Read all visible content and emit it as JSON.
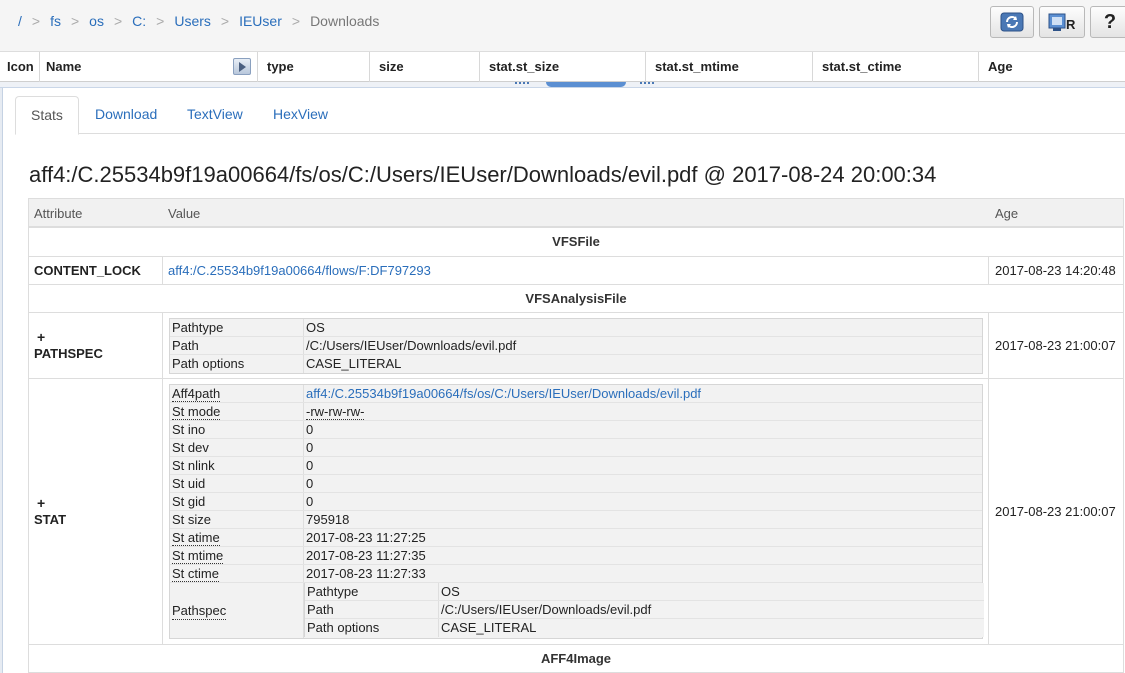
{
  "breadcrumb": [
    "/",
    "fs",
    "os",
    "C:",
    "Users",
    "IEUser",
    "Downloads"
  ],
  "toolbar": {
    "refresh_icon": "refresh-icon",
    "rekall_icon": "rekall-icon",
    "help_icon": "help-icon",
    "help_label": "?"
  },
  "file_columns": [
    "Icon",
    "Name",
    "type",
    "size",
    "stat.st_size",
    "stat.st_mtime",
    "stat.st_ctime",
    "Age"
  ],
  "tabs": [
    "Stats",
    "Download",
    "TextView",
    "HexView"
  ],
  "active_tab": "Stats",
  "page_title": "aff4:/C.25534b9f19a00664/fs/os/C:/Users/IEUser/Downloads/evil.pdf @ 2017-08-24 20:00:34",
  "table": {
    "headers": {
      "attribute": "Attribute",
      "value": "Value",
      "age": "Age"
    },
    "sections": {
      "vfsfile": "VFSFile",
      "vfsanalysisfile": "VFSAnalysisFile",
      "aff4image": "AFF4Image"
    },
    "content_lock": {
      "name": "CONTENT_LOCK",
      "value": "aff4:/C.25534b9f19a00664/flows/F:DF797293",
      "age": "2017-08-23 14:20:48"
    },
    "pathspec": {
      "expander": "+",
      "name": "PATHSPEC",
      "age": "2017-08-23 21:00:07",
      "rows": [
        {
          "k": "Pathtype",
          "v": "OS"
        },
        {
          "k": "Path",
          "v": "/C:/Users/IEUser/Downloads/evil.pdf"
        },
        {
          "k": "Path options",
          "v": "CASE_LITERAL"
        }
      ]
    },
    "stat": {
      "expander": "+",
      "name": "STAT",
      "age": "2017-08-23 21:00:07",
      "rows": [
        {
          "k": "Aff4path",
          "v": "aff4:/C.25534b9f19a00664/fs/os/C:/Users/IEUser/Downloads/evil.pdf"
        },
        {
          "k": "St mode",
          "v": "-rw-rw-rw-"
        },
        {
          "k": "St ino",
          "v": "0"
        },
        {
          "k": "St dev",
          "v": "0"
        },
        {
          "k": "St nlink",
          "v": "0"
        },
        {
          "k": "St uid",
          "v": "0"
        },
        {
          "k": "St gid",
          "v": "0"
        },
        {
          "k": "St size",
          "v": "795918"
        },
        {
          "k": "St atime",
          "v": "2017-08-23 11:27:25"
        },
        {
          "k": "St mtime",
          "v": "2017-08-23 11:27:35"
        },
        {
          "k": "St ctime",
          "v": "2017-08-23 11:27:33"
        }
      ],
      "pathspec_label": "Pathspec",
      "pathspec_rows": [
        {
          "k": "Pathtype",
          "v": "OS"
        },
        {
          "k": "Path",
          "v": "/C:/Users/IEUser/Downloads/evil.pdf"
        },
        {
          "k": "Path options",
          "v": "CASE_LITERAL"
        }
      ]
    }
  }
}
